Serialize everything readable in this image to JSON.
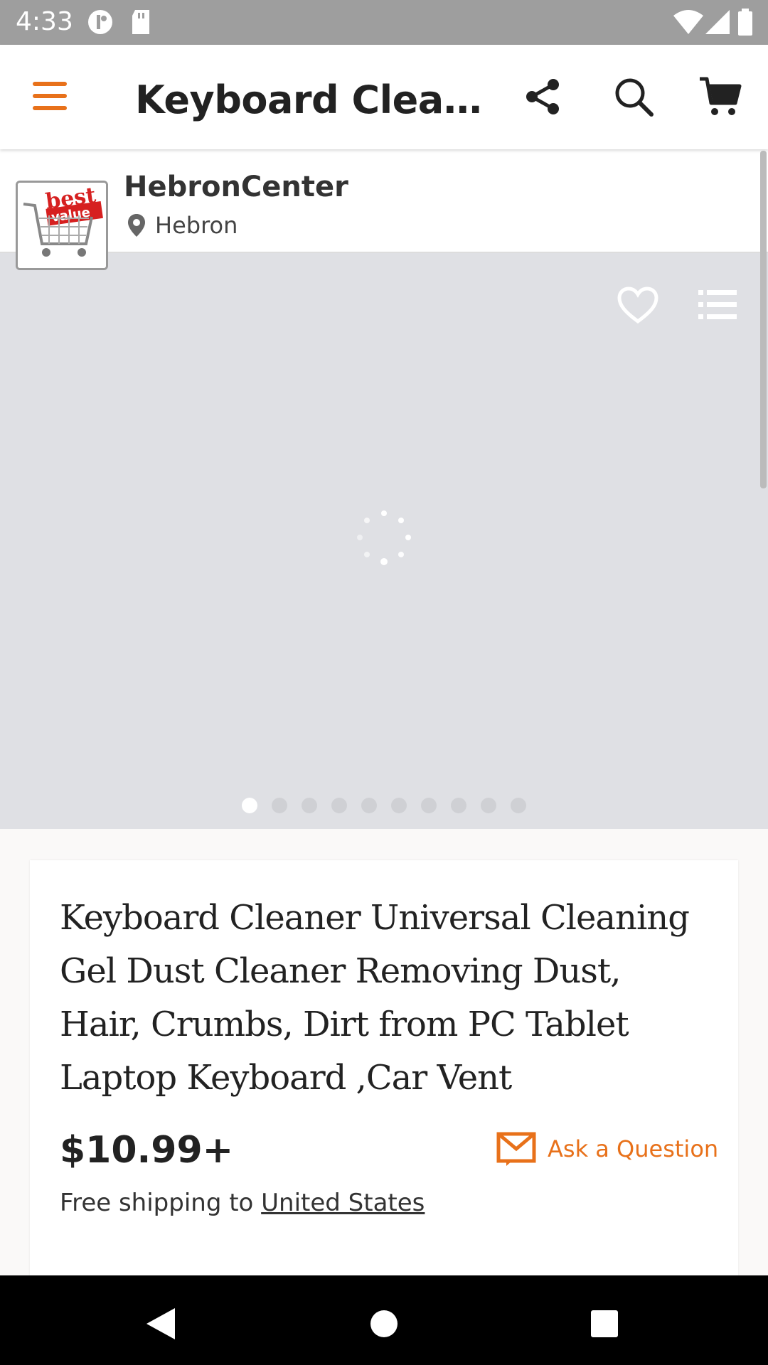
{
  "status_bar": {
    "time": "4:33"
  },
  "app_bar": {
    "title": "Keyboard Cleane..."
  },
  "shop": {
    "name": "HebronCenter",
    "location": "Hebron",
    "logo_text": "best value"
  },
  "gallery": {
    "dot_count": 10,
    "active_index": 0
  },
  "product": {
    "title": "Keyboard Cleaner Universal Cleaning Gel Dust Cleaner Removing Dust, Hair, Crumbs, Dirt from PC Tablet Laptop Keyboard ,Car Vent",
    "price": "$10.99+",
    "ask_label": "Ask a Question",
    "shipping_prefix": "Free shipping to ",
    "shipping_country": "United States"
  },
  "colors": {
    "accent": "#e8711a",
    "gallery_bg": "#dfe0e4"
  }
}
